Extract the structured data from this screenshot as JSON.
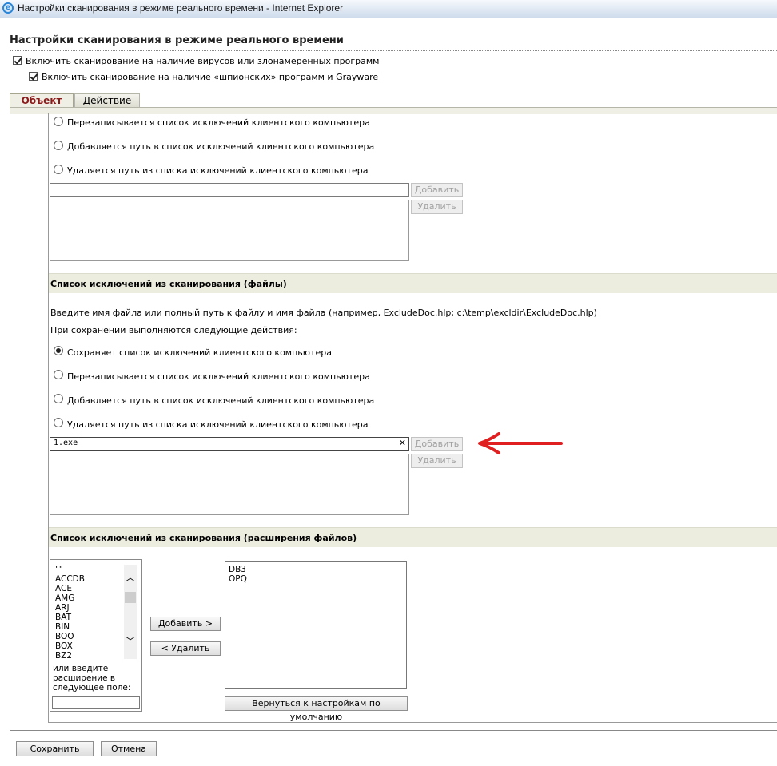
{
  "window": {
    "title": "Настройки сканирования в режиме реального времени - Internet Explorer"
  },
  "page": {
    "title": "Настройки сканирования в режиме реального времени",
    "enable_virus_scan": "Включить сканирование на наличие вирусов или злонамеренных программ",
    "enable_spyware_scan": "Включить сканирование на наличие «шпионских» программ и Grayware"
  },
  "tabs": [
    {
      "label": "Объект",
      "active": true
    },
    {
      "label": "Действие",
      "active": false
    }
  ],
  "dirs_section": {
    "options": [
      "Перезаписывается список исключений клиентского компьютера",
      "Добавляется путь в список исключений клиентского компьютера",
      "Удаляется путь из списка исключений клиентского компьютера"
    ],
    "input_value": "",
    "add_label": "Добавить",
    "remove_label": "Удалить"
  },
  "files_section": {
    "header": "Список исключений из сканирования (файлы)",
    "hint": "Введите имя файла или полный путь к файлу и имя файла (например, ExcludeDoc.hlp; c:\\temp\\excldir\\ExcludeDoc.hlp)",
    "on_save": "При сохранении выполняются следующие действия:",
    "options": [
      "Сохраняет список исключений клиентского компьютера",
      "Перезаписывается список исключений клиентского компьютера",
      "Добавляется путь в список исключений клиентского компьютера",
      "Удаляется путь из списка исключений клиентского компьютера"
    ],
    "selected_option": 0,
    "input_value": "1.exe",
    "clear_glyph": "✕",
    "add_label": "Добавить",
    "remove_label": "Удалить"
  },
  "ext_section": {
    "header": "Список исключений из сканирования (расширения файлов)",
    "available": [
      "\"\"",
      "ACCDB",
      "ACE",
      "AMG",
      "ARJ",
      "BAT",
      "BIN",
      "BOO",
      "BOX",
      "BZ2"
    ],
    "hint": [
      "или введите",
      "расширение в",
      "следующее поле:"
    ],
    "add_label": "Добавить >",
    "remove_label": "< Удалить",
    "selected": [
      "DB3",
      "OPQ"
    ],
    "reset_label": "Вернуться к настройкам по умолчанию"
  },
  "footer": {
    "save_label": "Сохранить",
    "cancel_label": "Отмена"
  },
  "colors": {
    "annotation_arrow": "#e02020",
    "active_tab_text": "#8b1a1a",
    "section_bg": "#ededdf"
  }
}
